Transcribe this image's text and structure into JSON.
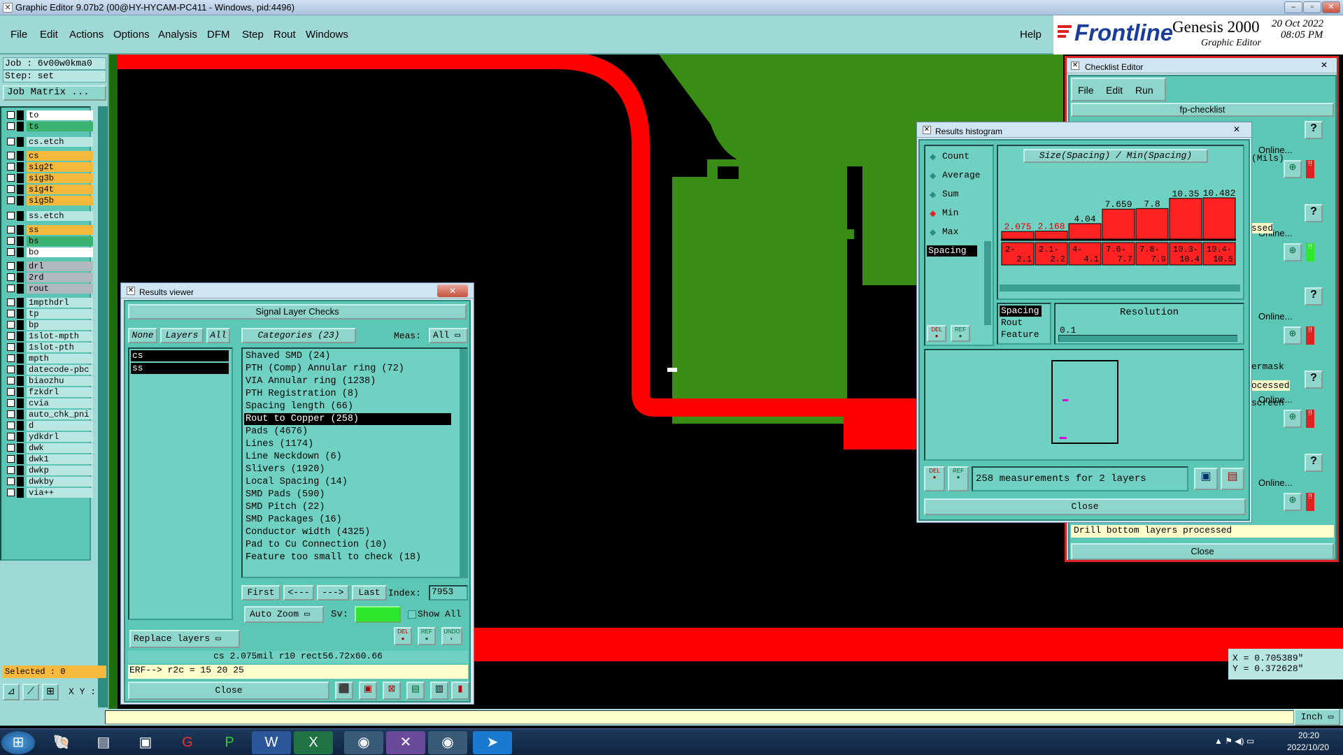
{
  "titlebar": {
    "title": "Graphic Editor 9.07b2 (00@HY-HYCAM-PC411 - Windows, pid:4496)"
  },
  "menubar": {
    "items": [
      "File",
      "Edit",
      "Actions",
      "Options",
      "Analysis",
      "DFM",
      "Step",
      "Rout",
      "Windows"
    ],
    "help": "Help"
  },
  "logo": {
    "brand": "Frontline",
    "product": "Genesis 2000",
    "subtitle": "Graphic Editor",
    "date": "20 Oct 2022",
    "time": "08:05 PM"
  },
  "sidebar": {
    "job": "Job : 6v00w0kma0",
    "step": "Step: set",
    "job_matrix": "Job Matrix ...",
    "layers": [
      {
        "name": "to",
        "color": "#ffffff"
      },
      {
        "name": "ts",
        "color": "#3cb371"
      },
      {
        "name": "cs.etch",
        "color": "#b7e6e3"
      },
      {
        "name": "cs",
        "color": "#f6b93b"
      },
      {
        "name": "sig2t",
        "color": "#f6b93b"
      },
      {
        "name": "sig3b",
        "color": "#f6b93b"
      },
      {
        "name": "sig4t",
        "color": "#f6b93b"
      },
      {
        "name": "sig5b",
        "color": "#f6b93b"
      },
      {
        "name": "ss.etch",
        "color": "#b7e6e3"
      },
      {
        "name": "ss",
        "color": "#f6b93b"
      },
      {
        "name": "bs",
        "color": "#3cb371"
      },
      {
        "name": "bo",
        "color": "#ffffff"
      },
      {
        "name": "drl",
        "color": "#b0b8c0"
      },
      {
        "name": "2rd",
        "color": "#b0b8c0"
      },
      {
        "name": "rout",
        "color": "#b0b8c0"
      },
      {
        "name": "1mpthdrl",
        "color": "#b7e6e3"
      },
      {
        "name": "tp",
        "color": "#b7e6e3"
      },
      {
        "name": "bp",
        "color": "#b7e6e3"
      },
      {
        "name": "1slot-mpth",
        "color": "#b7e6e3"
      },
      {
        "name": "1slot-pth",
        "color": "#b7e6e3"
      },
      {
        "name": "mpth",
        "color": "#b7e6e3"
      },
      {
        "name": "datecode-pbc",
        "color": "#b7e6e3"
      },
      {
        "name": "biaozhu",
        "color": "#b7e6e3"
      },
      {
        "name": "fzkdrl",
        "color": "#b7e6e3"
      },
      {
        "name": "cvia",
        "color": "#b7e6e3"
      },
      {
        "name": "auto_chk_pni",
        "color": "#b7e6e3"
      },
      {
        "name": "d",
        "color": "#b7e6e3"
      },
      {
        "name": "ydkdrl",
        "color": "#b7e6e3"
      },
      {
        "name": "dwk",
        "color": "#b7e6e3"
      },
      {
        "name": "dwk1",
        "color": "#b7e6e3"
      },
      {
        "name": "dwkp",
        "color": "#b7e6e3"
      },
      {
        "name": "dwkby",
        "color": "#b7e6e3"
      },
      {
        "name": "via++",
        "color": "#b7e6e3"
      }
    ],
    "selected": "Selected : 0"
  },
  "results_viewer": {
    "title": "Results viewer",
    "header": "Signal Layer Checks",
    "none_btn": "None",
    "layers_btn": "Layers",
    "all_btn": "All",
    "categories_label": "Categories (23)",
    "meas_label": "Meas:",
    "meas_value": "All",
    "layer_list": [
      "cs",
      "ss"
    ],
    "categories": [
      "Shaved SMD (24)",
      "PTH (Comp) Annular ring (72)",
      "VIA Annular ring (1238)",
      "PTH Registration (8)",
      "Spacing length (66)",
      "Rout to Copper (258)",
      "Pads (4676)",
      "Lines (1174)",
      "Line Neckdown (6)",
      "Slivers (1920)",
      "Local Spacing (14)",
      "SMD Pads (590)",
      "SMD Pitch (22)",
      "SMD Packages (16)",
      "Conductor width (4325)",
      "Pad to Cu Connection (10)",
      "Feature too small to check (18)"
    ],
    "selected_category": "Rout to Copper (258)",
    "nav": {
      "first": "First",
      "prev": "<---",
      "next": "--->",
      "last": "Last",
      "index_label": "Index:",
      "index_value": "7953"
    },
    "auto_zoom": "Auto Zoom",
    "sv_label": "Sv:",
    "show_all": "Show All",
    "replace_layers": "Replace layers",
    "icon_btns": [
      "DEL",
      "REF",
      "UNDO"
    ],
    "status_line": "cs 2.075mil  r10  rect56.72x60.66",
    "erf_line": "ERF--> r2c = 15 20 25",
    "close": "Close"
  },
  "histogram": {
    "title": "Results histogram",
    "options": [
      {
        "label": "Count",
        "checked": false
      },
      {
        "label": "Average",
        "checked": false
      },
      {
        "label": "Sum",
        "checked": false
      },
      {
        "label": "Min",
        "checked": true
      },
      {
        "label": "Max",
        "checked": false
      }
    ],
    "measure_list": [
      "Spacing"
    ],
    "chart_title": "Size(Spacing) / Min(Spacing)",
    "chart_data": {
      "type": "bar",
      "title": "Size(Spacing) / Min(Spacing)",
      "categories": [
        "2-2.1",
        "2.1-2.2",
        "4-4.1",
        "7.6-7.7",
        "7.8-7.9",
        "10.3-10.4",
        "10.4-10.5"
      ],
      "value_labels": [
        "2.075",
        "2.168",
        "4.04",
        "7.659",
        "7.8",
        "10.35",
        "10.482"
      ],
      "values": [
        2.075,
        2.168,
        4.04,
        7.659,
        7.8,
        10.35,
        10.482
      ]
    },
    "lower_list": [
      "Spacing",
      "Rout",
      "Feature"
    ],
    "resolution_label": "Resolution",
    "resolution_value": "0.1",
    "measurements": "258 measurements for 2 layers",
    "small_btns": [
      "DEL",
      "REF"
    ],
    "close": "Close"
  },
  "checklist": {
    "title": "Checklist Editor",
    "menu": [
      "File",
      "Edit",
      "Run"
    ],
    "name": "fp-checklist",
    "row_texts": [
      "Online...",
      "Online...",
      "Online...",
      "Online...",
      "Online..."
    ],
    "side_texts": [
      "(Mils)",
      "ssed",
      "ermask",
      "ocessed",
      "screen"
    ],
    "footer_text": "Drill bottom layers processed",
    "close": "Close"
  },
  "coords": {
    "x": "X = 0.705389\"",
    "y": "Y = 0.372628\""
  },
  "units": "Inch",
  "xy_label": "X Y :",
  "taskbar": {
    "time": "20:20",
    "date": "2022/10/20"
  }
}
